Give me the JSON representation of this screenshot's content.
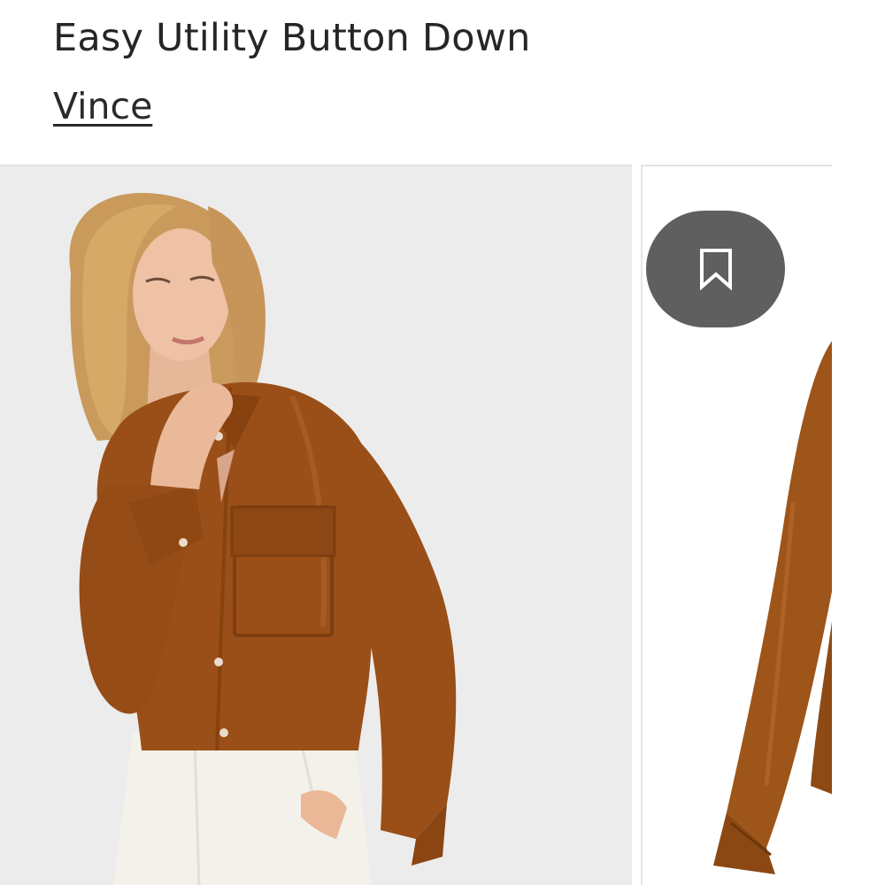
{
  "product": {
    "title": "Easy Utility Button Down",
    "brand": "Vince"
  },
  "gallery": {
    "images": [
      {
        "icon": "model-wearing-shirt-photo"
      },
      {
        "icon": "shirt-flat-lay-photo"
      }
    ],
    "save_button": {
      "icon": "bookmark-icon"
    }
  },
  "colors": {
    "shirt": "#9a4f18",
    "photo_background": "#ececec",
    "save_button_bg": "#5f5f5f",
    "text": "#262626"
  }
}
